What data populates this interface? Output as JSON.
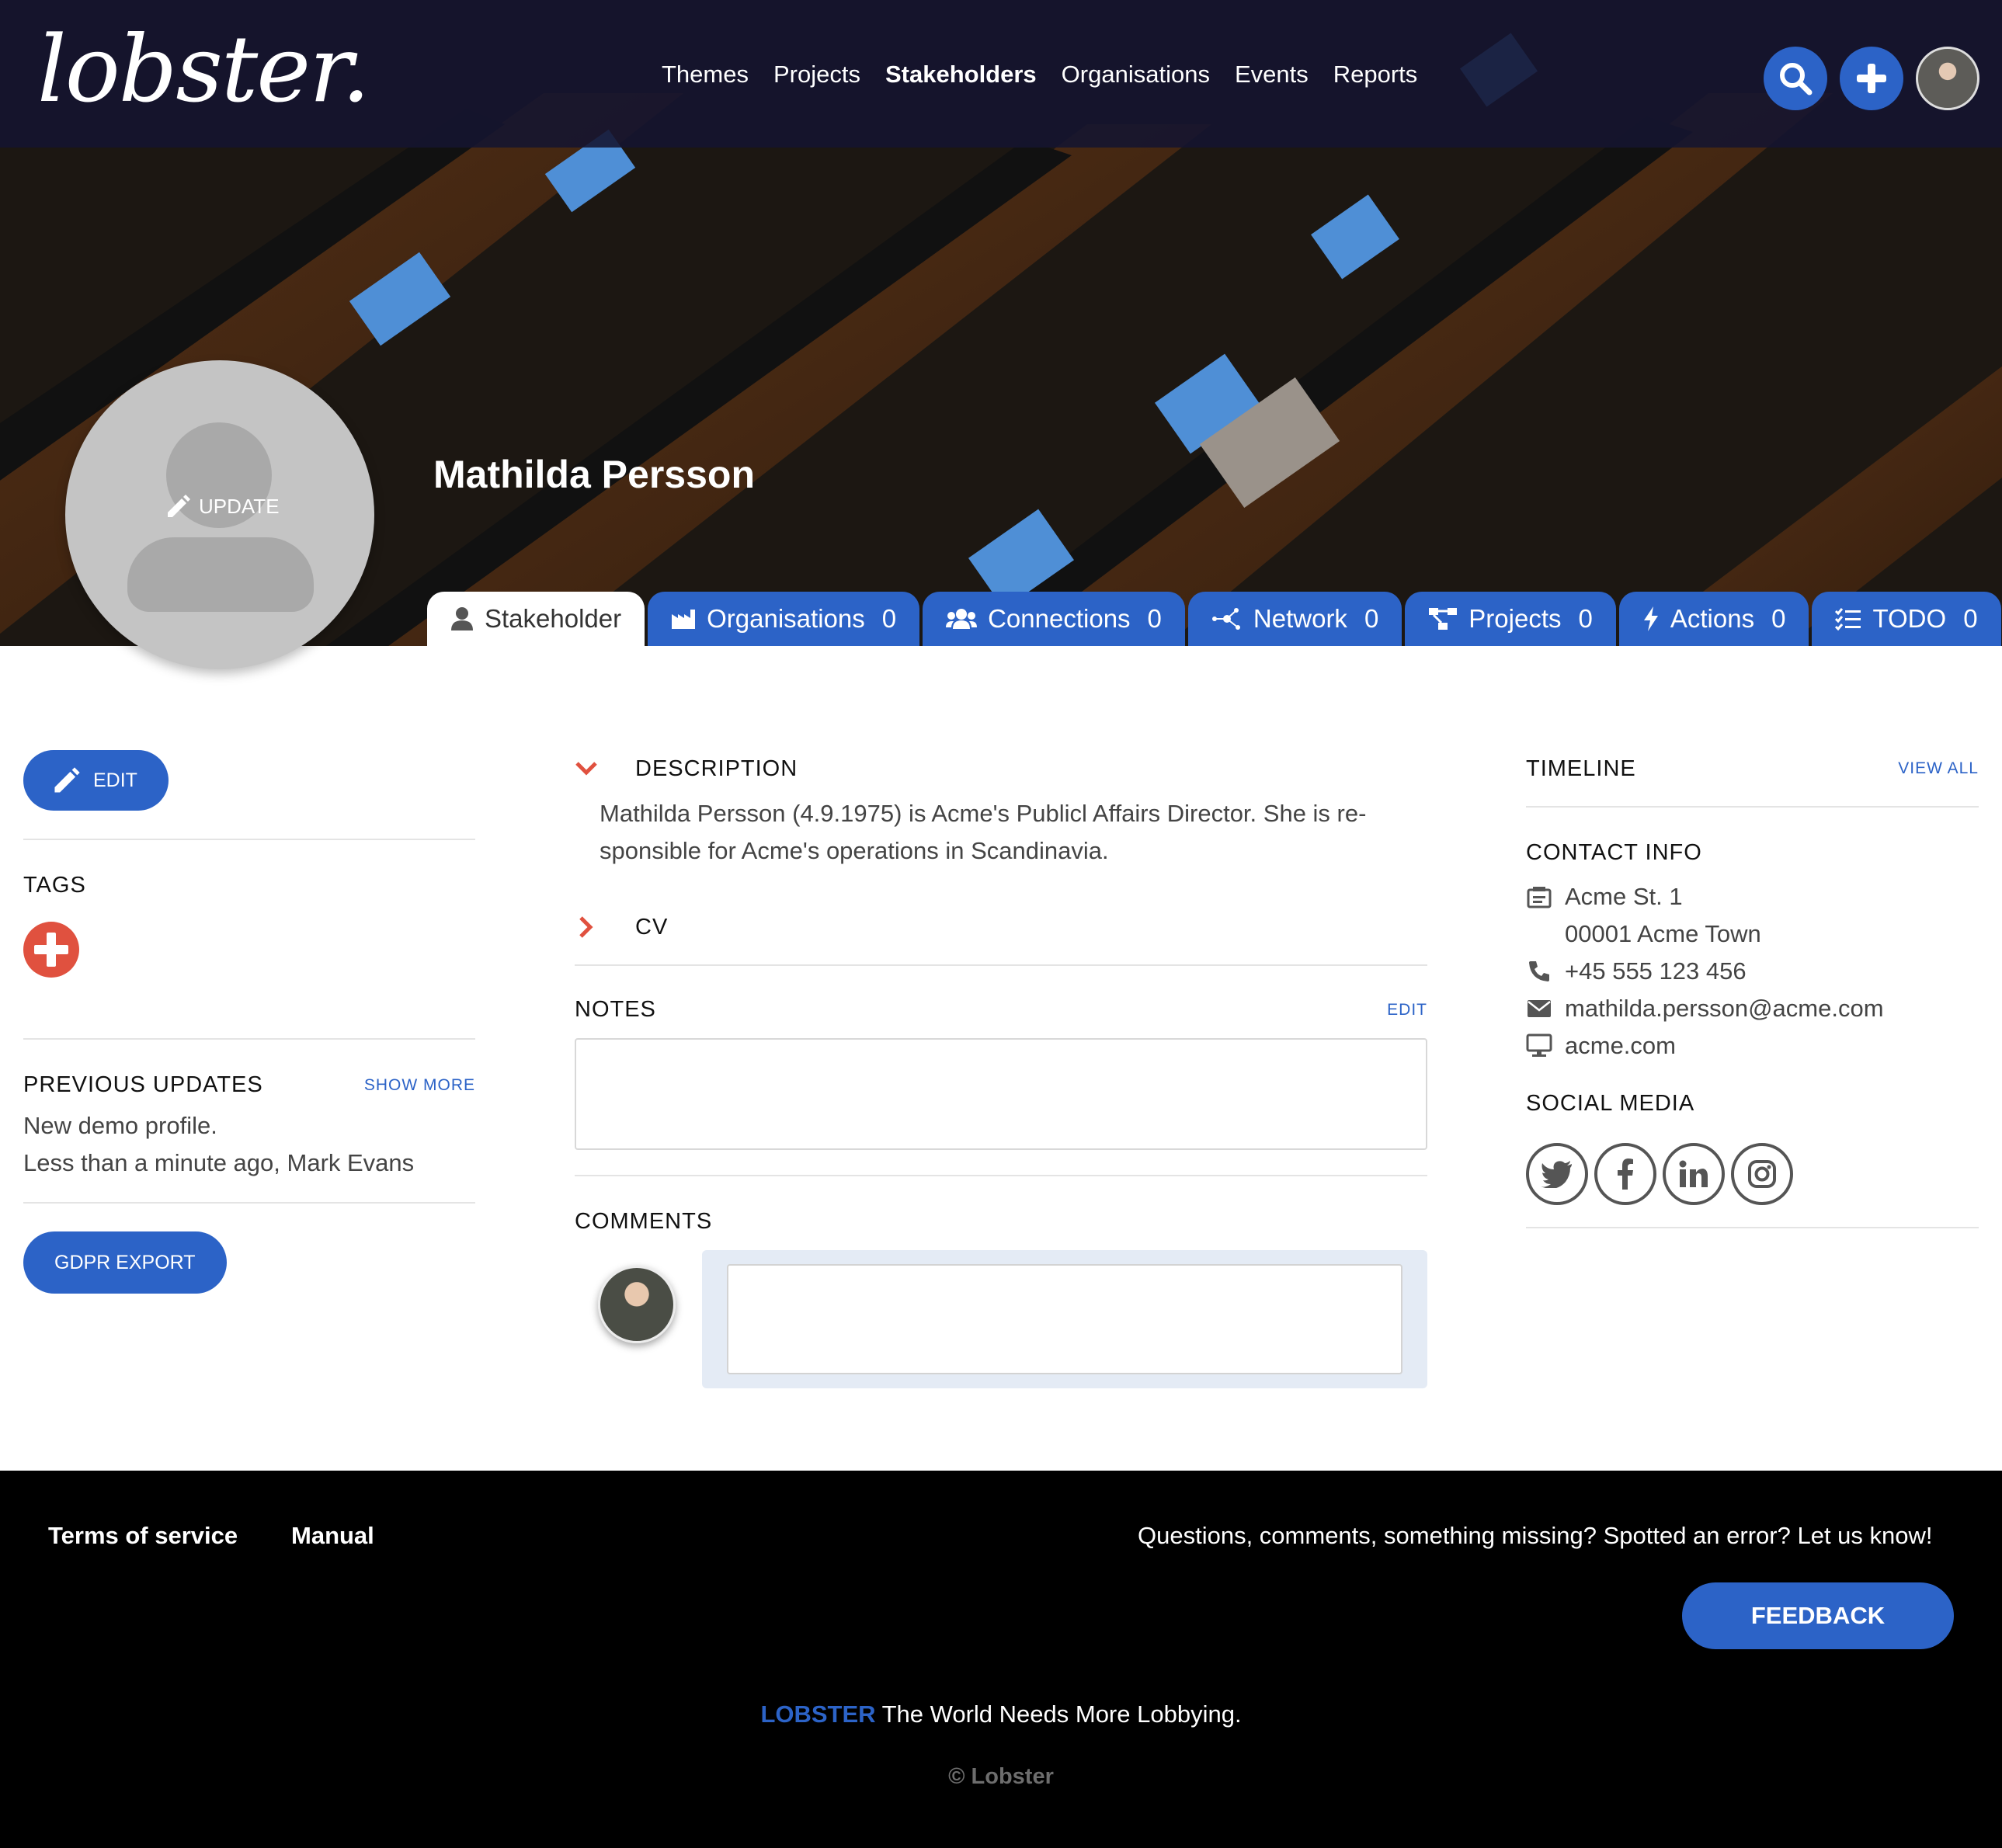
{
  "brand": {
    "logo": "lobster.",
    "accent": "#2c63c7",
    "danger": "#e0513f"
  },
  "nav": {
    "items": [
      {
        "label": "Themes"
      },
      {
        "label": "Projects"
      },
      {
        "label": "Stakeholders",
        "active": true
      },
      {
        "label": "Organisations"
      },
      {
        "label": "Events"
      },
      {
        "label": "Reports"
      }
    ],
    "icons": [
      "search-icon",
      "plus-icon",
      "user-avatar"
    ]
  },
  "profile": {
    "name": "Mathilda Persson",
    "avatar_update_label": "UPDATE"
  },
  "tabs": [
    {
      "label": "Stakeholder",
      "icon": "person-icon",
      "active": true
    },
    {
      "label": "Organisations",
      "count": "0",
      "icon": "factory-icon"
    },
    {
      "label": "Connections",
      "count": "0",
      "icon": "people-icon"
    },
    {
      "label": "Network",
      "count": "0",
      "icon": "network-icon"
    },
    {
      "label": "Projects",
      "count": "0",
      "icon": "project-icon"
    },
    {
      "label": "Actions",
      "count": "0",
      "icon": "bolt-icon"
    },
    {
      "label": "TODO",
      "count": "0",
      "icon": "checklist-icon"
    }
  ],
  "left": {
    "edit_label": "EDIT",
    "tags_title": "TAGS",
    "updates_title": "PREVIOUS UPDATES",
    "show_more": "SHOW MORE",
    "update_text": "New demo profile.",
    "update_meta": "Less than a minute ago, Mark Evans",
    "gdpr_label": "GDPR EXPORT"
  },
  "middle": {
    "description_title": "DESCRIPTION",
    "description_line1": "Mathilda Persson (4.9.1975) is Acme's Publicl Affairs Director. She is re-",
    "description_line2": "sponsible for Acme's operations in Scandinavia.",
    "cv_title": "CV",
    "notes_title": "NOTES",
    "notes_edit": "EDIT",
    "notes_value": "",
    "comments_title": "COMMENTS",
    "comment_value": ""
  },
  "right": {
    "timeline_title": "TIMELINE",
    "view_all": "VIEW ALL",
    "contact_title": "CONTACT INFO",
    "address_line1": "Acme St. 1",
    "address_line2": "00001 Acme Town",
    "phone": "+45 555 123 456",
    "email": "mathilda.persson@acme.com",
    "website": "acme.com",
    "social_title": "SOCIAL MEDIA",
    "social": [
      "twitter-icon",
      "facebook-icon",
      "linkedin-icon",
      "instagram-icon"
    ]
  },
  "footer": {
    "terms": "Terms of service",
    "manual": "Manual",
    "question": "Questions, comments, something missing? Spotted an error? Let us know!",
    "feedback": "FEEDBACK",
    "tagline_brand": "LOBSTER",
    "tagline_text": " The World Needs More Lobbying.",
    "copyright": "© Lobster"
  }
}
